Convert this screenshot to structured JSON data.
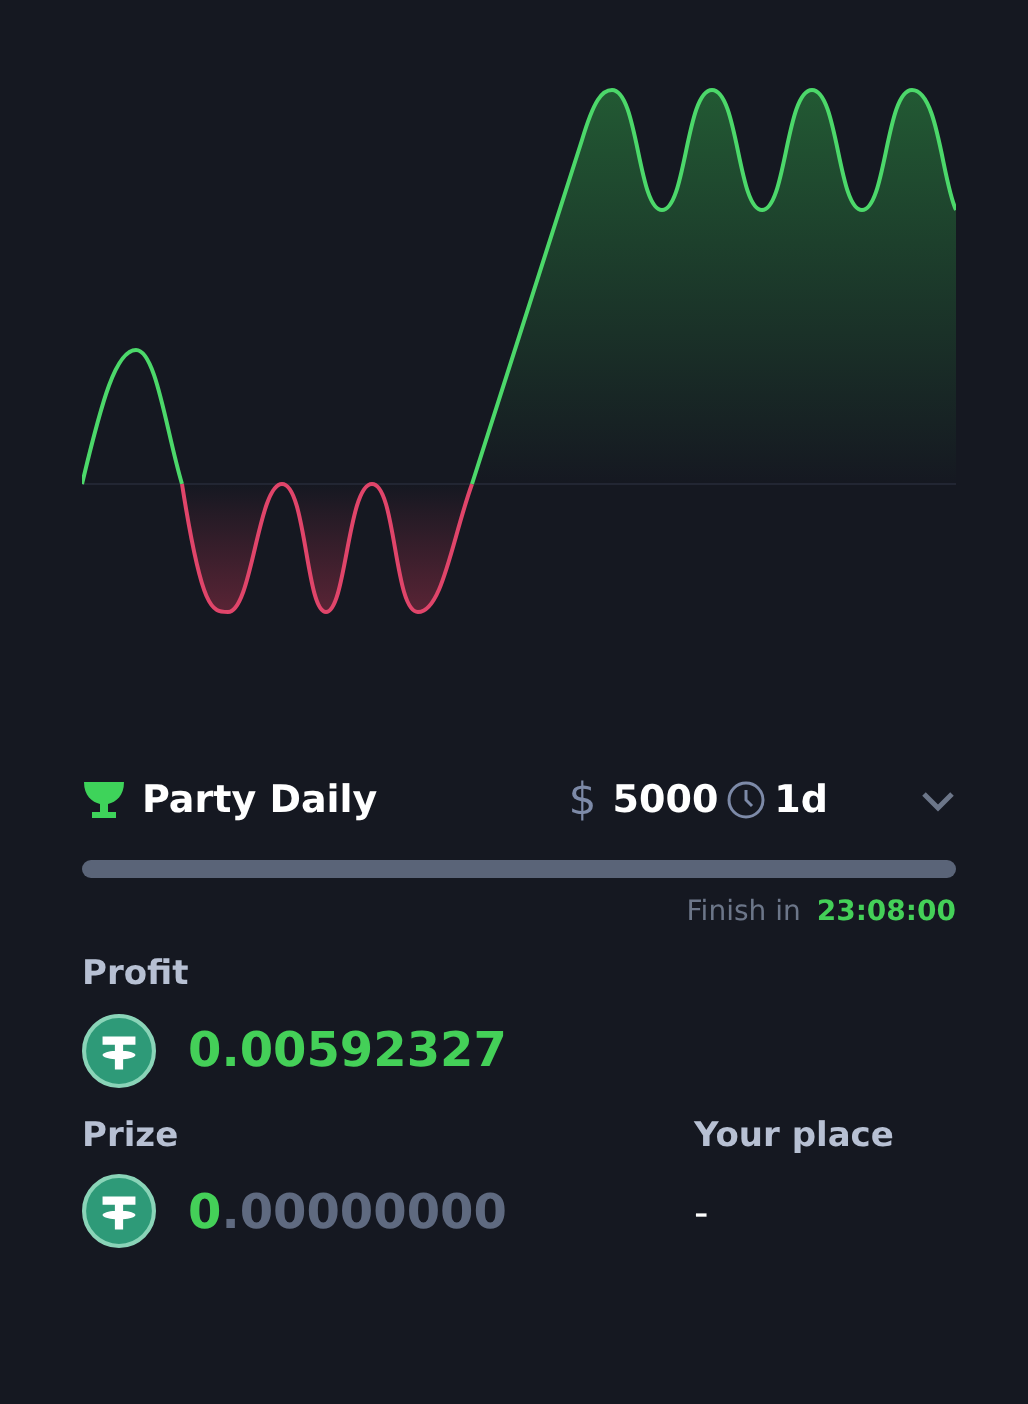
{
  "tournament": {
    "title": "Party Daily",
    "currency_symbol": "$",
    "amount": "5000",
    "duration": "1d",
    "expanded": false
  },
  "finish": {
    "label": "Finish in",
    "time": "23:08:00"
  },
  "profit": {
    "label": "Profit",
    "value": "0.00592327"
  },
  "prize": {
    "label": "Prize",
    "value_whole": "0",
    "value_fraction": ".00000000"
  },
  "place": {
    "label": "Your place",
    "value": "-"
  }
}
